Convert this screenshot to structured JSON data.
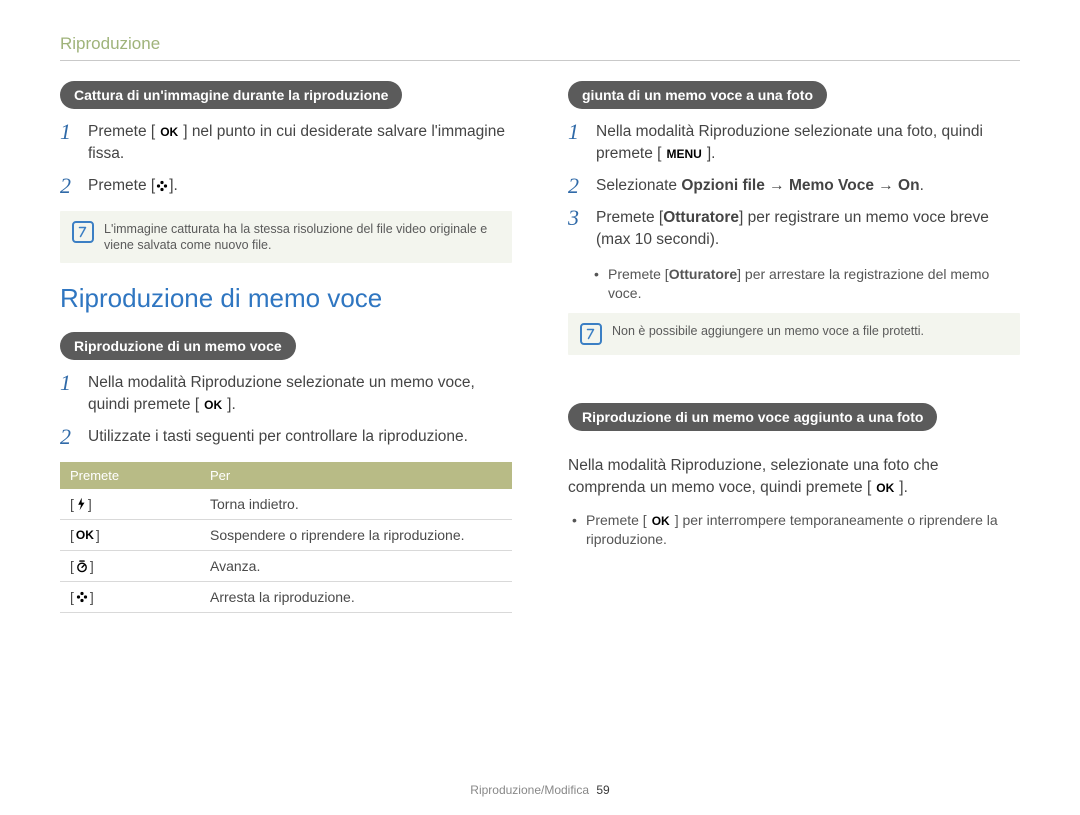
{
  "header": {
    "section": "Riproduzione"
  },
  "footer": {
    "label": "Riproduzione/Modifica",
    "page": "59"
  },
  "icons": {
    "ok": "OK",
    "menu": "MENU"
  },
  "left": {
    "capture": {
      "pill": "Cattura di un'immagine durante la riproduzione",
      "steps": [
        {
          "pre": "Premete [",
          "btn": "OK",
          "post": "] nel punto in cui desiderate salvare l'immagine fissa."
        },
        {
          "pre": "Premete [",
          "btn": "flower",
          "post": "]."
        }
      ],
      "note": "L'immagine catturata ha la stessa risoluzione del file video originale e viene salvata come nuovo file."
    },
    "memo_heading": "Riproduzione di memo voce",
    "memo_play": {
      "pill": "Riproduzione di un memo voce",
      "steps": [
        {
          "pre": "Nella modalità Riproduzione selezionate un memo voce, quindi premete [",
          "btn": "OK",
          "post": "]."
        },
        {
          "pre": "Utilizzate i tasti seguenti per controllare la riproduzione."
        }
      ],
      "table": {
        "head": {
          "a": "Premete",
          "b": "Per"
        },
        "rows": [
          {
            "btn": "flash",
            "desc": "Torna indietro."
          },
          {
            "btn": "OK",
            "desc": "Sospendere o riprendere la riproduzione."
          },
          {
            "btn": "timer",
            "desc": "Avanza."
          },
          {
            "btn": "flower",
            "desc": "Arresta la riproduzione."
          }
        ]
      }
    }
  },
  "right": {
    "add": {
      "pill": "giunta di un memo voce a una foto",
      "steps": [
        {
          "pre": "Nella modalità Riproduzione selezionate una foto, quindi premete [",
          "btn": "MENU",
          "post": "]."
        },
        {
          "plain_pre": "Selezionate ",
          "strong": "Opzioni file → Memo Voce → On",
          "plain_post": "."
        },
        {
          "pre": "Premete [",
          "strong": "Otturatore",
          "post": "] per registrare un memo voce breve (max 10 secondi)."
        }
      ],
      "sub_bullet": {
        "pre": "Premete [",
        "strong": "Otturatore",
        "post": "] per arrestare la registrazione del memo voce."
      },
      "note": "Non è possibile aggiungere un memo voce a file protetti."
    },
    "play_attached": {
      "pill": "Riproduzione di un memo voce aggiunto a una foto",
      "para": {
        "pre": "Nella modalità Riproduzione, selezionate una foto che comprenda un memo voce, quindi premete [",
        "btn": "OK",
        "post": "]."
      },
      "bullet": {
        "pre": "Premete [",
        "btn": "OK",
        "post": "] per interrompere temporaneamente o riprendere la riproduzione."
      }
    }
  }
}
